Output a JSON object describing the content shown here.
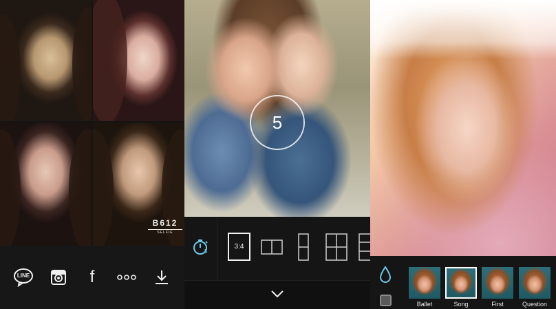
{
  "panel1": {
    "brand": {
      "name": "B612",
      "tagline": "SELFIE"
    },
    "share_buttons": [
      {
        "icon": "line-icon",
        "label": "LINE"
      },
      {
        "icon": "instagram-icon"
      },
      {
        "icon": "facebook-icon",
        "label": "f"
      },
      {
        "icon": "more-icon"
      },
      {
        "icon": "download-icon"
      }
    ]
  },
  "panel2": {
    "countdown": "5",
    "timer": {
      "icon": "timer-icon",
      "value": "5"
    },
    "ratio_label": "3:4",
    "layouts": [
      "two-horizontal",
      "two-vertical",
      "four-grid",
      "three-vertical"
    ],
    "collapse_icon": "chevron-down-icon"
  },
  "panel3": {
    "filter_icon": "drop-icon",
    "filters": [
      {
        "name": "Ballet",
        "selected": false
      },
      {
        "name": "Song",
        "selected": true
      },
      {
        "name": "First",
        "selected": false
      },
      {
        "name": "Question",
        "selected": false
      }
    ]
  },
  "colors": {
    "bar": "#151515",
    "icon": "#f0f0f0",
    "accent": "#6fc8e8"
  }
}
